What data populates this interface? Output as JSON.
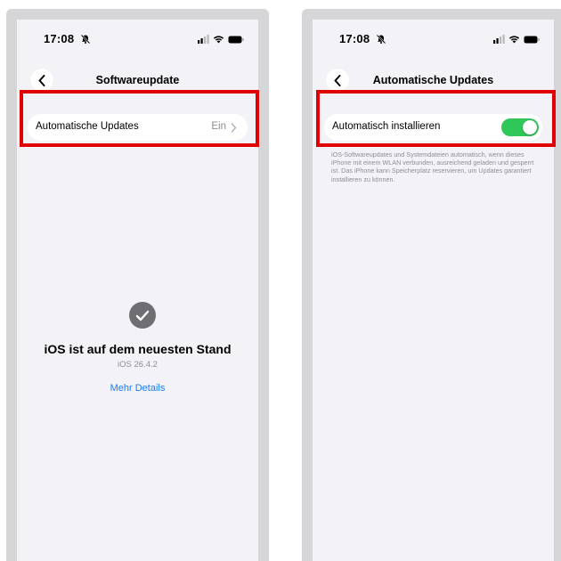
{
  "screens": [
    {
      "status": {
        "time": "17:08"
      },
      "nav": {
        "title": "Softwareupdate"
      },
      "settings_row": {
        "label": "Automatische Updates",
        "value": "Ein"
      },
      "update_status": {
        "title": "iOS ist auf dem neuesten Stand",
        "version": "iOS 26.4.2",
        "link": "Mehr Details"
      }
    },
    {
      "status": {
        "time": "17:08"
      },
      "nav": {
        "title": "Automatische Updates"
      },
      "settings_row": {
        "label": "Automatisch installieren",
        "toggle_on": true
      },
      "footnote": "iOS-Softwareupdates und Systemdateien automatisch, wenn dieses iPhone mit einem WLAN verbunden, ausreichend geladen und gesperrt ist. Das iPhone kann Speicherplatz reservieren, um Updates garantiert installieren zu können."
    }
  ],
  "colors": {
    "highlight": "#e10000",
    "toggle_on": "#30c759",
    "link": "#1a7cf5",
    "secondary_text": "#8e8e93"
  },
  "icons": [
    "mute-bell-icon",
    "cellular-icon",
    "wifi-icon",
    "battery-icon",
    "back-chevron-icon",
    "chevron-right-icon",
    "checkmark-icon"
  ]
}
